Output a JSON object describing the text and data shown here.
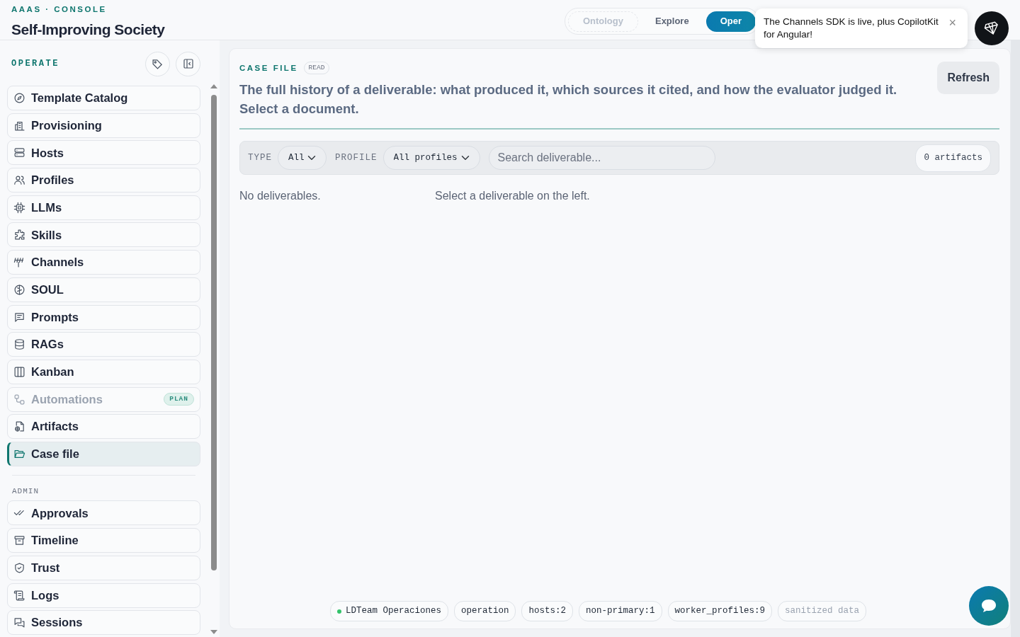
{
  "header": {
    "kicker": "AAAS · CONSOLE",
    "title": "Self-Improving Society"
  },
  "top_tabs": [
    {
      "label": "Ontology",
      "selected": false,
      "disabled": true
    },
    {
      "label": "Explore",
      "selected": false,
      "disabled": false
    },
    {
      "label": "Oper",
      "selected": true,
      "disabled": false
    }
  ],
  "toast": {
    "text": "The Channels SDK is live, plus CopilotKit for Angular!",
    "close": "×"
  },
  "sidebar": {
    "section": "OPERATE",
    "items": [
      {
        "label": "Template Catalog",
        "selected": false,
        "disabled": false
      },
      {
        "label": "Provisioning",
        "selected": false,
        "disabled": false
      },
      {
        "label": "Hosts",
        "selected": false,
        "disabled": false
      },
      {
        "label": "Profiles",
        "selected": false,
        "disabled": false
      },
      {
        "label": "LLMs",
        "selected": false,
        "disabled": false
      },
      {
        "label": "Skills",
        "selected": false,
        "disabled": false
      },
      {
        "label": "Channels",
        "selected": false,
        "disabled": false
      },
      {
        "label": "SOUL",
        "selected": false,
        "disabled": false
      },
      {
        "label": "Prompts",
        "selected": false,
        "disabled": false
      },
      {
        "label": "RAGs",
        "selected": false,
        "disabled": false
      },
      {
        "label": "Kanban",
        "selected": false,
        "disabled": false
      },
      {
        "label": "Automations",
        "selected": false,
        "disabled": true,
        "badge": "PLAN"
      },
      {
        "label": "Artifacts",
        "selected": false,
        "disabled": false
      },
      {
        "label": "Case file",
        "selected": true,
        "disabled": false
      }
    ],
    "admin_section": "ADMIN",
    "admin_items": [
      {
        "label": "Approvals",
        "selected": false,
        "disabled": false
      },
      {
        "label": "Timeline",
        "selected": false,
        "disabled": false
      },
      {
        "label": "Trust",
        "selected": false,
        "disabled": false
      },
      {
        "label": "Logs",
        "selected": false,
        "disabled": false
      },
      {
        "label": "Sessions",
        "selected": false,
        "disabled": false
      }
    ]
  },
  "main": {
    "kicker": "CASE FILE",
    "badge": "READ",
    "description": "The full history of a deliverable: what produced it, which sources it cited, and how the evaluator judged it. Select a document.",
    "refresh": "Refresh",
    "filters": {
      "type_label": "TYPE",
      "type_value": "All",
      "profile_label": "PROFILE",
      "profile_value": "All profiles",
      "search_placeholder": "Search deliverable...",
      "count": "0 artifacts"
    },
    "empty_list": "No deliverables.",
    "empty_detail": "Select a deliverable on the left.",
    "chips": [
      {
        "text": "LDTeam Operaciones",
        "color": "#34c36b",
        "disabled": false
      },
      {
        "text": "operation",
        "disabled": false
      },
      {
        "text": "hosts:2",
        "disabled": false
      },
      {
        "text": "non-primary:1",
        "disabled": false
      },
      {
        "text": "worker_profiles:9",
        "disabled": false
      },
      {
        "text": "sanitized data",
        "disabled": true
      }
    ]
  }
}
